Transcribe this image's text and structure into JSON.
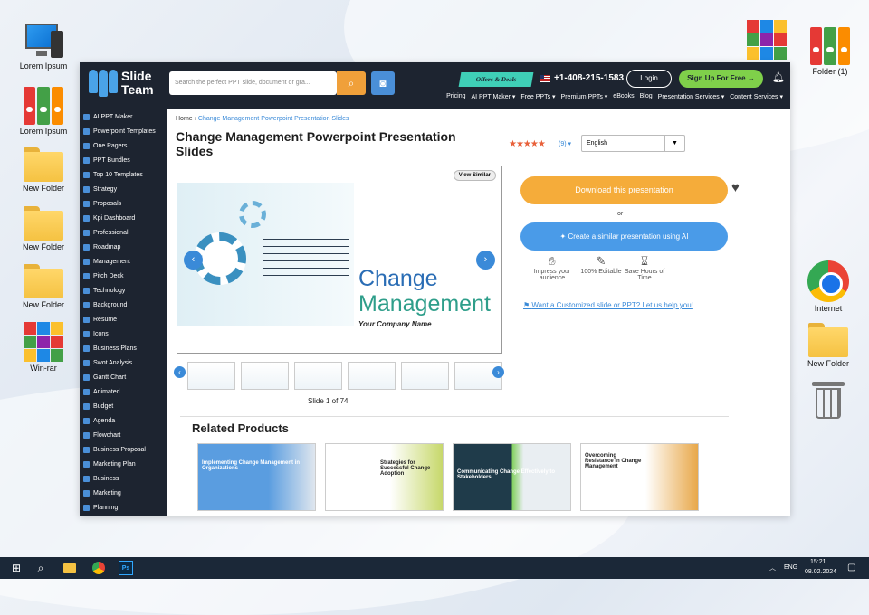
{
  "desktop": {
    "icons_left": [
      {
        "label": "Lorem Ipsum",
        "icon": "computer-icon"
      },
      {
        "label": "Lorem Ipsum",
        "icon": "binders-icon"
      },
      {
        "label": "New Folder",
        "icon": "folder-icon"
      },
      {
        "label": "New Folder",
        "icon": "folder-icon"
      },
      {
        "label": "New Folder",
        "icon": "folder-icon"
      },
      {
        "label": "Win-rar",
        "icon": "winrar-icon"
      }
    ],
    "icons_right": [
      {
        "label": "",
        "icon": "winrar-icon"
      },
      {
        "label": "Folder (1)",
        "icon": "binders-icon"
      },
      {
        "label": "Internet",
        "icon": "chrome-icon"
      },
      {
        "label": "New Folder",
        "icon": "folder-icon"
      },
      {
        "label": "",
        "icon": "trash-icon"
      }
    ]
  },
  "site": {
    "logo_line1": "Slide",
    "logo_line2": "Team",
    "search_placeholder": "Search the perfect PPT slide, document or gra...",
    "offers": "Offers & Deals",
    "phone": "+1-408-215-1583",
    "login": "Login",
    "signup": "Sign Up For Free →",
    "nav": [
      "Pricing",
      "AI PPT Maker ▾",
      "Free PPTs ▾",
      "Premium PPTs ▾",
      "eBooks",
      "Blog",
      "Presentation Services ▾",
      "Content Services ▾"
    ]
  },
  "sidebar": [
    "AI PPT Maker",
    "Powerpoint Templates",
    "One Pagers",
    "PPT Bundles",
    "Top 10 Templates",
    "Strategy",
    "Proposals",
    "Kpi Dashboard",
    "Professional",
    "Roadmap",
    "Management",
    "Pitch Deck",
    "Technology",
    "Background",
    "Resume",
    "Icons",
    "Business Plans",
    "Swot Analysis",
    "Gantt Chart",
    "Animated",
    "Budget",
    "Agenda",
    "Flowchart",
    "Business Proposal",
    "Marketing Plan",
    "Business",
    "Marketing",
    "Planning"
  ],
  "product": {
    "breadcrumb_home": "Home",
    "breadcrumb_current": "Change Management Powerpoint Presentation Slides",
    "title": "Change Management Powerpoint Presentation Slides",
    "stars": "★★★★★",
    "rating_count": "(9) ▾",
    "language": "English",
    "view_similar": "View Similar",
    "slide_title_1": "Change",
    "slide_title_2": "Management",
    "slide_subtitle": "Your Company Name",
    "slide_counter": "Slide 1 of 74",
    "download": "Download this presentation",
    "or": "or",
    "ai_button": "Create a similar presentation using AI",
    "features": [
      {
        "icon": "hand-icon",
        "text": "Impress your audience"
      },
      {
        "icon": "edit-icon",
        "text": "100% Editable"
      },
      {
        "icon": "hourglass-icon",
        "text": "Save Hours of Time"
      }
    ],
    "custom_link": "Want a Customized slide or PPT? Let us help you!"
  },
  "related": {
    "heading": "Related Products",
    "items": [
      {
        "title": "Implementing Change Management in Organizations"
      },
      {
        "title": "Strategies for Successful Change Adoption"
      },
      {
        "title": "Communicating Change Effectively to Stakeholders"
      },
      {
        "title": "Overcoming Resistance in Change Management"
      }
    ]
  },
  "taskbar": {
    "lang": "ENG",
    "time": "15:21",
    "date": "08.02.2024",
    "ps_label": "Ps"
  }
}
